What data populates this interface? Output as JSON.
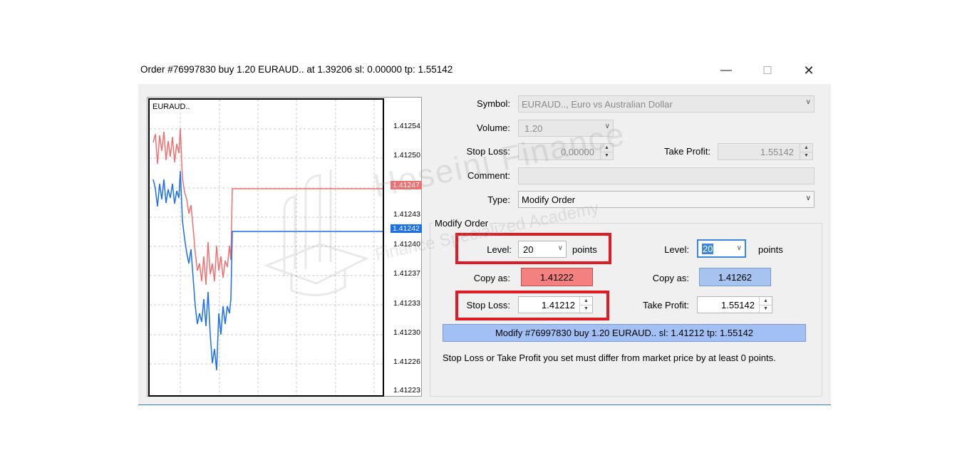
{
  "window": {
    "title": "Order #76997830 buy 1.20 EURAUD.. at 1.39206 sl: 0.00000 tp: 1.55142",
    "minimize": "—",
    "maximize": "☐",
    "close": "✕"
  },
  "chart": {
    "symbol": "EURAUD..",
    "ticks": [
      "1.41254",
      "1.41250",
      "1.41247",
      "1.41243",
      "1.41242",
      "1.41240",
      "1.41237",
      "1.41233",
      "1.41230",
      "1.41226",
      "1.41223"
    ],
    "ask_label": "1.41247",
    "bid_label": "1.41242",
    "ask_color": "#f07070",
    "bid_color": "#1a6ef0"
  },
  "form": {
    "symbol_label": "Symbol:",
    "symbol_value": "EURAUD.., Euro vs Australian Dollar",
    "volume_label": "Volume:",
    "volume_value": "1.20",
    "stoploss_label": "Stop Loss:",
    "stoploss_value": "0.00000",
    "takeprofit_label": "Take Profit:",
    "takeprofit_value": "1.55142",
    "comment_label": "Comment:",
    "comment_value": "",
    "type_label": "Type:",
    "type_value": "Modify Order"
  },
  "modify": {
    "group_title": "Modify Order",
    "left_level_label": "Level:",
    "left_level_value": "20",
    "left_points": "points",
    "right_level_label": "Level:",
    "right_level_value": "20",
    "right_points": "points",
    "copy_as_left_label": "Copy as:",
    "copy_as_left_value": "1.41222",
    "copy_as_right_label": "Copy as:",
    "copy_as_right_value": "1.41262",
    "sl_label": "Stop Loss:",
    "sl_value": "1.41212",
    "tp_label": "Take Profit:",
    "tp_value": "1.55142",
    "modify_button": "Modify #76997830 buy 1.20 EURAUD.. sl: 1.41212 tp: 1.55142",
    "note": "Stop Loss or Take Profit you set must differ from market price by at least 0 points."
  },
  "watermark": {
    "line1": "Hoseini Finance",
    "line2": "Finance Specialized Academy"
  },
  "colors": {
    "copy_left_bg": "#f58080",
    "copy_right_bg": "#a7c3f0",
    "modify_bg": "#a3c0f5",
    "highlight_red": "#e01b24"
  }
}
